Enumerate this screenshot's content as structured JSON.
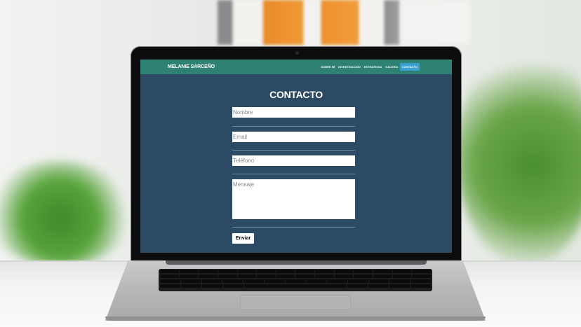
{
  "site": {
    "brand": "MELANIE SARCEÑO",
    "nav": [
      {
        "label": "SOBRE MÍ"
      },
      {
        "label": "INVESTIGACIÓN"
      },
      {
        "label": "ESTRATEGIA"
      },
      {
        "label": "GALERÍA"
      },
      {
        "label": "CONTACTO",
        "active": true
      }
    ]
  },
  "contact": {
    "title": "CONTACTO",
    "name_placeholder": "Nombre",
    "email_placeholder": "Email",
    "phone_placeholder": "Teléfono",
    "message_placeholder": "Mensaje",
    "submit_label": "Enviar"
  },
  "colors": {
    "navbar": "#2e8173",
    "page_background": "#2c4a64",
    "active_nav": "#3aa0d0"
  }
}
